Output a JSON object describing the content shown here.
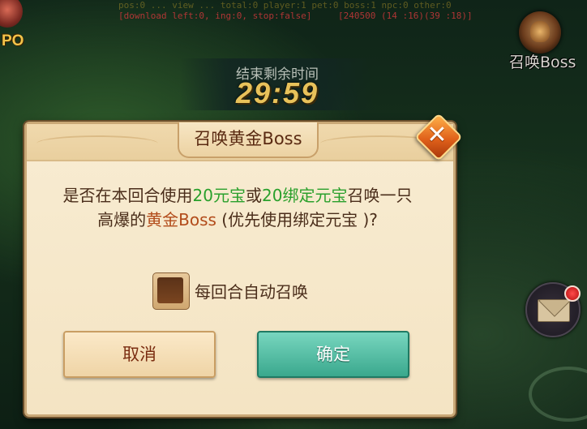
{
  "debug": {
    "line1": "[download left:0, ing:0, stop:false]",
    "line2": "[240500 (14 :16)(39 :18)]"
  },
  "left_badge": {
    "text": "PO"
  },
  "timer": {
    "label": "结束剩余时间",
    "value": "29:59"
  },
  "summon_boss_button": {
    "label": "召唤Boss",
    "icon": "boss-emblem-icon"
  },
  "mail": {
    "icon": "mail-icon",
    "has_notification": true
  },
  "dialog": {
    "title": "召唤黄金Boss",
    "message_parts": {
      "p1": "是否在本回合使用",
      "yuanbao": "20元宝",
      "p2": "或",
      "bound_yuanbao": "20绑定元宝",
      "p3": "召唤一只",
      "p4": "高爆的",
      "golden_boss": "黄金Boss",
      "p5": " (优先使用绑定元宝 )?"
    },
    "auto_summon": {
      "label": "每回合自动召唤",
      "checked": false
    },
    "cancel_label": "取消",
    "confirm_label": "确定",
    "close_icon": "close-icon"
  },
  "colors": {
    "highlight_green": "#2aa02c",
    "highlight_brown": "#b24b1a",
    "timer_gold": "#e8c25a",
    "confirm_teal": "#3aa88d"
  }
}
